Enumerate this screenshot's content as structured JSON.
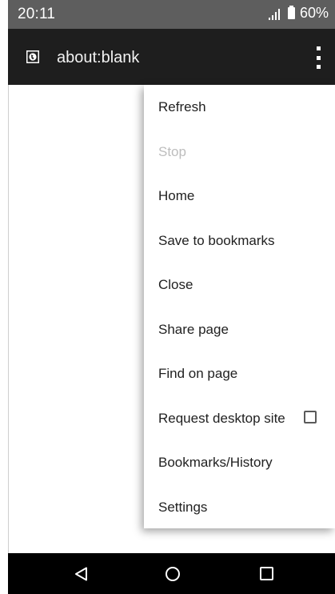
{
  "status_bar": {
    "time": "20:11",
    "battery": "60%"
  },
  "toolbar": {
    "url": "about:blank"
  },
  "menu": {
    "items": [
      {
        "label": "Refresh",
        "enabled": true
      },
      {
        "label": "Stop",
        "enabled": false
      },
      {
        "label": "Home",
        "enabled": true
      },
      {
        "label": "Save to bookmarks",
        "enabled": true
      },
      {
        "label": "Close",
        "enabled": true
      },
      {
        "label": "Share page",
        "enabled": true
      },
      {
        "label": "Find on page",
        "enabled": true
      },
      {
        "label": "Request desktop site",
        "enabled": true,
        "checked": false
      },
      {
        "label": "Bookmarks/History",
        "enabled": true
      },
      {
        "label": "Settings",
        "enabled": true
      }
    ]
  },
  "icons": {
    "site": "globe-icon",
    "overflow": "more-vert-icon",
    "back": "back-icon",
    "home": "home-icon",
    "recents": "recents-icon"
  },
  "colors": {
    "status_bar": "#5e5e5e",
    "toolbar": "#1e1e1e",
    "nav_bar": "#000000",
    "menu_text": "#212121",
    "menu_disabled_text": "#bdbdbd"
  }
}
